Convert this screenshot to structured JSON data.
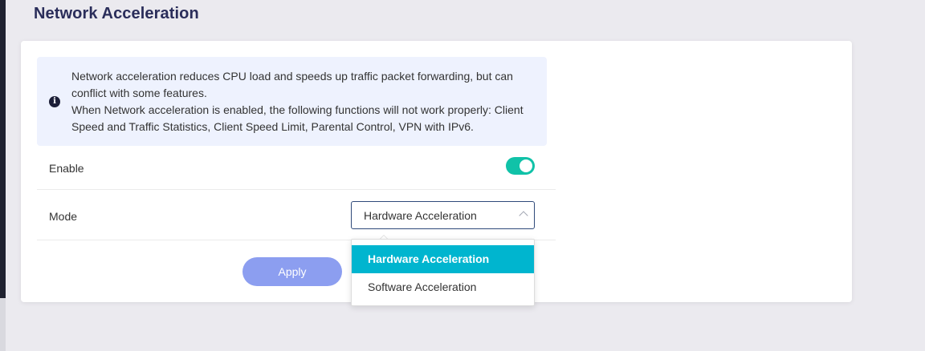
{
  "page": {
    "title": "Network Acceleration"
  },
  "notice": {
    "icon": "info-icon",
    "line1": "Network acceleration reduces CPU load and speeds up traffic packet forwarding, but can conflict with some features.",
    "line2": "When Network acceleration is enabled, the following functions will not work properly: Client Speed and Traffic Statistics, Client Speed Limit, Parental Control, VPN with IPv6."
  },
  "settings": {
    "enable_label": "Enable",
    "enable_state": true,
    "mode_label": "Mode",
    "mode_value": "Hardware Acceleration",
    "mode_options": [
      "Hardware Acceleration",
      "Software Acceleration"
    ]
  },
  "actions": {
    "apply_label": "Apply"
  },
  "colors": {
    "accent": "#10c2a8",
    "selected_option": "#00b5cf",
    "apply_button": "#8c9ef0",
    "title": "#2a2d5a"
  }
}
